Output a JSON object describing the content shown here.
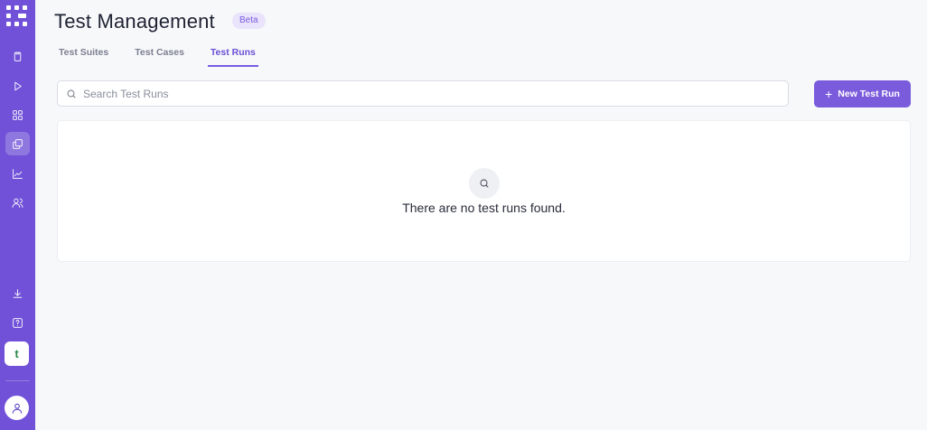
{
  "app": {
    "sidebar": {
      "logo": "dots-logo",
      "items": [
        {
          "icon": "clipboard-icon",
          "active": false
        },
        {
          "icon": "play-icon",
          "active": false
        },
        {
          "icon": "grid-icon",
          "active": false
        },
        {
          "icon": "copy-icon",
          "active": true
        },
        {
          "icon": "chart-icon",
          "active": false
        },
        {
          "icon": "users-icon",
          "active": false
        }
      ],
      "bottom_items": [
        {
          "icon": "download-icon"
        },
        {
          "icon": "help-icon"
        }
      ],
      "workspace_letter": "t",
      "avatar_icon": "user-icon",
      "color": "#7051d8"
    }
  },
  "header": {
    "title": "Test Management",
    "badge": "Beta"
  },
  "tabs": [
    {
      "label": "Test Suites",
      "active": false
    },
    {
      "label": "Test Cases",
      "active": false
    },
    {
      "label": "Test Runs",
      "active": true
    }
  ],
  "search": {
    "placeholder": "Search Test Runs",
    "value": ""
  },
  "actions": {
    "new_button_icon": "+",
    "new_button_label": "New Test Run",
    "accent_color": "#7a5bdc"
  },
  "empty_state": {
    "icon": "search-icon",
    "message": "There are no test runs found."
  }
}
